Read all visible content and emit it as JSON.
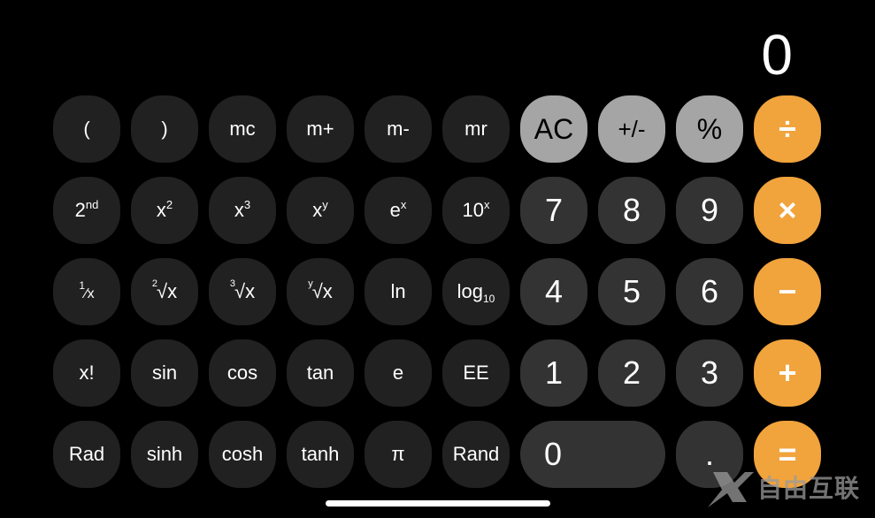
{
  "display": {
    "value": "0"
  },
  "colors": {
    "background": "#000000",
    "scientific_key": "#212121",
    "digit_key": "#333333",
    "function_key": "#a5a5a5",
    "operator_key": "#f1a33c"
  },
  "keys": {
    "open_paren": "(",
    "close_paren": ")",
    "mc": "mc",
    "m_plus": "m+",
    "m_minus": "m-",
    "mr": "mr",
    "ac": "AC",
    "plus_minus": "+/-",
    "percent": "%",
    "divide": "÷",
    "second": {
      "base": "2",
      "sup": "nd"
    },
    "x_squared": {
      "base": "x",
      "sup": "2"
    },
    "x_cubed": {
      "base": "x",
      "sup": "3"
    },
    "x_power_y": {
      "base": "x",
      "sup": "y"
    },
    "e_power_x": {
      "base": "e",
      "sup": "x"
    },
    "ten_power_x": {
      "base": "10",
      "sup": "x"
    },
    "seven": "7",
    "eight": "8",
    "nine": "9",
    "multiply": "×",
    "reciprocal": {
      "num": "1",
      "den": "x"
    },
    "sqrt": {
      "index": "2",
      "radical": "√x"
    },
    "cbrt": {
      "index": "3",
      "radical": "√x"
    },
    "yroot": {
      "index": "y",
      "radical": "√x"
    },
    "ln": "ln",
    "log10": {
      "base": "log",
      "sub": "10"
    },
    "four": "4",
    "five": "5",
    "six": "6",
    "minus": "−",
    "factorial": "x!",
    "sin": "sin",
    "cos": "cos",
    "tan": "tan",
    "e": "e",
    "ee": "EE",
    "one": "1",
    "two": "2",
    "three": "3",
    "plus": "+",
    "rad": "Rad",
    "sinh": "sinh",
    "cosh": "cosh",
    "tanh": "tanh",
    "pi": "π",
    "rand": "Rand",
    "zero": "0",
    "decimal": ".",
    "equals": "="
  },
  "watermark": {
    "text": "自由互联"
  }
}
